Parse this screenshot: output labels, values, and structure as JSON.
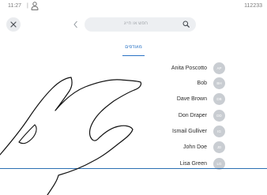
{
  "status": {
    "time": "11:27",
    "separator": "|",
    "extension": "112233"
  },
  "search": {
    "placeholder": "חפש או חייג"
  },
  "tabs": [
    {
      "label": "מועדפים"
    }
  ],
  "contacts": [
    {
      "name": "Anita Poscotto",
      "initials": "AP"
    },
    {
      "name": "Bob",
      "initials": "BH"
    },
    {
      "name": "Dave Brown",
      "initials": "DB"
    },
    {
      "name": "Don Draper",
      "initials": "DD"
    },
    {
      "name": "Ismail Gulliver",
      "initials": "IG"
    },
    {
      "name": "John Doe",
      "initials": "JD"
    },
    {
      "name": "Lisa Green",
      "initials": "LG"
    }
  ],
  "colors": {
    "accent": "#2a73c5",
    "avatar": "#c9cdd2"
  },
  "icons": {
    "user": "user-icon",
    "close": "close-icon",
    "back": "chevron-left-icon",
    "search": "search-icon"
  }
}
